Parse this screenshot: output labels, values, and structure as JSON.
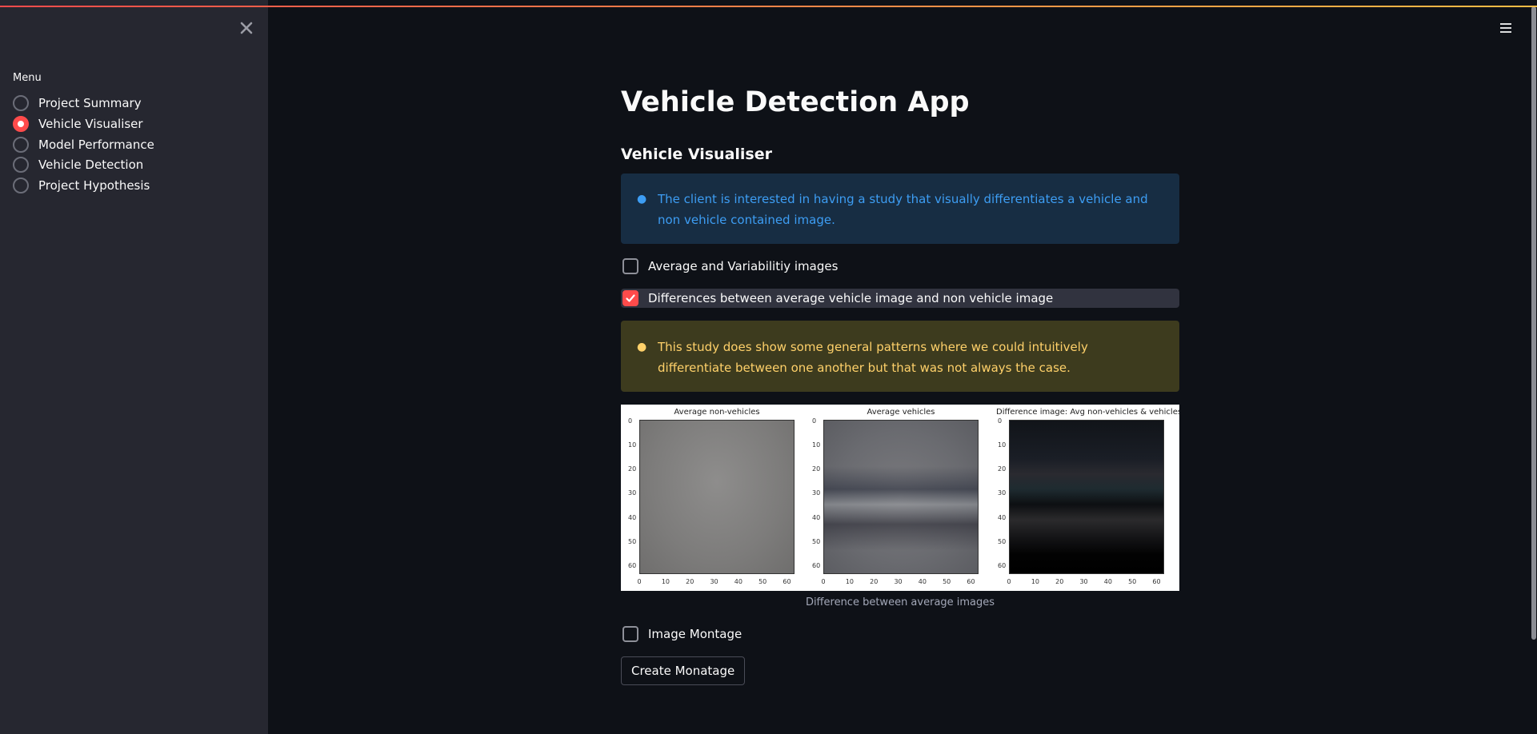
{
  "sidebar": {
    "menu_label": "Menu",
    "items": [
      {
        "label": "Project Summary",
        "selected": false
      },
      {
        "label": "Vehicle Visualiser",
        "selected": true
      },
      {
        "label": "Model Performance",
        "selected": false
      },
      {
        "label": "Vehicle Detection",
        "selected": false
      },
      {
        "label": "Project Hypothesis",
        "selected": false
      }
    ],
    "close_icon": "close-icon"
  },
  "header": {
    "menu_icon": "hamburger-menu-icon"
  },
  "main": {
    "title": "Vehicle Detection App",
    "subheader": "Vehicle Visualiser",
    "info_text": "The client is interested in having a study that visually differentiates a vehicle and non vehicle contained image.",
    "checkbox_avg": {
      "label": "Average and Variabilitiy images",
      "checked": false
    },
    "checkbox_diff": {
      "label": "Differences between average vehicle image and non vehicle image",
      "checked": true
    },
    "warning_text": "This study does show some general patterns where we could intuitively differentiate between one another but that was not always the case.",
    "figure": {
      "panels": [
        {
          "title": "Average non-vehicles"
        },
        {
          "title": "Average vehicles"
        },
        {
          "title": "Difference image: Avg non-vehicles & vehicles"
        }
      ],
      "y_ticks": [
        "0",
        "10",
        "20",
        "30",
        "40",
        "50",
        "60"
      ],
      "x_ticks": [
        "0",
        "10",
        "20",
        "30",
        "40",
        "50",
        "60"
      ]
    },
    "caption": "Difference between average images",
    "checkbox_montage": {
      "label": "Image Montage",
      "checked": false
    },
    "button_label": "Create Monatage"
  },
  "colors": {
    "accent": "#ff4b4b",
    "background": "#0e1117",
    "sidebar": "#262730",
    "info": "#3d9df3",
    "warning": "#ffd16a"
  }
}
